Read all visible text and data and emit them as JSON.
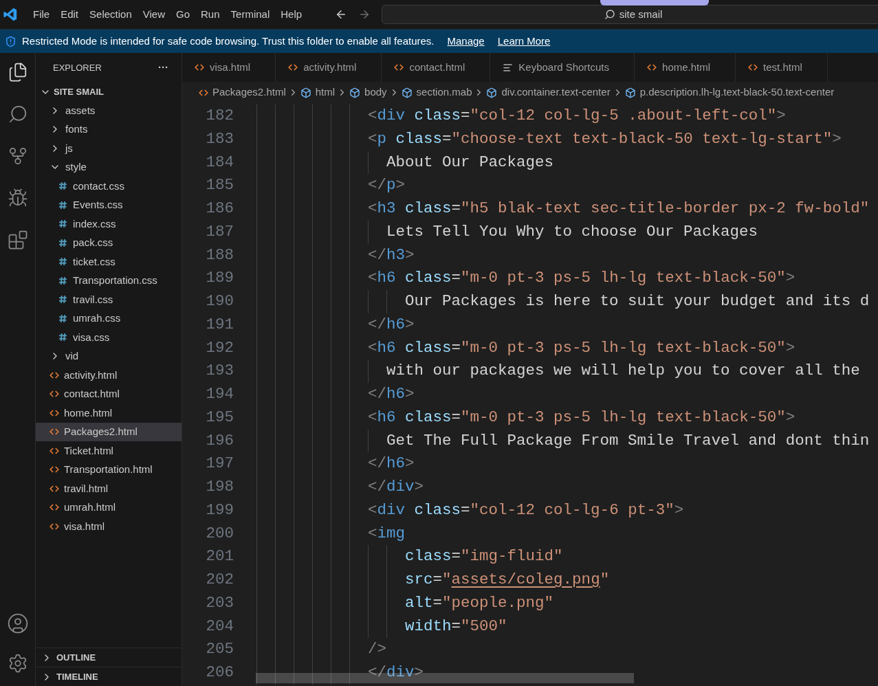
{
  "menu": [
    "File",
    "Edit",
    "Selection",
    "View",
    "Go",
    "Run",
    "Terminal",
    "Help"
  ],
  "command_center": {
    "text": "site smail"
  },
  "banner": {
    "message": "Restricted Mode is intended for safe code browsing. Trust this folder to enable all features.",
    "links": [
      "Manage",
      "Learn More"
    ]
  },
  "explorer": {
    "title": "EXPLORER",
    "more": "···",
    "folder": {
      "name": "SITE SMAIL",
      "expanded": true,
      "children": [
        {
          "kind": "folder",
          "name": "assets",
          "expanded": false,
          "selected": false
        },
        {
          "kind": "folder",
          "name": "fonts",
          "expanded": false,
          "selected": false
        },
        {
          "kind": "folder",
          "name": "js",
          "expanded": false,
          "selected": false
        },
        {
          "kind": "folder",
          "name": "style",
          "expanded": true,
          "selected": false,
          "children": [
            {
              "kind": "css",
              "name": "contact.css",
              "selected": false
            },
            {
              "kind": "css",
              "name": "Events.css",
              "selected": false
            },
            {
              "kind": "css",
              "name": "index.css",
              "selected": false
            },
            {
              "kind": "css",
              "name": "pack.css",
              "selected": false
            },
            {
              "kind": "css",
              "name": "ticket.css",
              "selected": false
            },
            {
              "kind": "css",
              "name": "Transportation.css",
              "selected": false
            },
            {
              "kind": "css",
              "name": "travil.css",
              "selected": false
            },
            {
              "kind": "css",
              "name": "umrah.css",
              "selected": false
            },
            {
              "kind": "css",
              "name": "visa.css",
              "selected": false
            }
          ]
        },
        {
          "kind": "folder",
          "name": "vid",
          "expanded": false,
          "selected": false
        },
        {
          "kind": "html",
          "name": "activity.html",
          "selected": false
        },
        {
          "kind": "html",
          "name": "contact.html",
          "selected": false
        },
        {
          "kind": "html",
          "name": "home.html",
          "selected": false
        },
        {
          "kind": "html",
          "name": "Packages2.html",
          "selected": true
        },
        {
          "kind": "html",
          "name": "Ticket.html",
          "selected": false
        },
        {
          "kind": "html",
          "name": "Transportation.html",
          "selected": false
        },
        {
          "kind": "html",
          "name": "travil.html",
          "selected": false
        },
        {
          "kind": "html",
          "name": "umrah.html",
          "selected": false
        },
        {
          "kind": "html",
          "name": "visa.html",
          "selected": false
        }
      ]
    },
    "sections": [
      {
        "title": "OUTLINE",
        "expanded": false
      },
      {
        "title": "TIMELINE",
        "expanded": false
      }
    ]
  },
  "tabs": [
    {
      "kind": "html",
      "label": "visa.html",
      "selected": false
    },
    {
      "kind": "html",
      "label": "activity.html",
      "selected": false
    },
    {
      "kind": "html",
      "label": "contact.html",
      "selected": false
    },
    {
      "kind": "settings",
      "label": "Keyboard Shortcuts",
      "selected": false
    },
    {
      "kind": "html",
      "label": "home.html",
      "selected": false
    },
    {
      "kind": "html",
      "label": "test.html",
      "selected": false
    }
  ],
  "breadcrumb": [
    {
      "kind": "html",
      "text": "Packages2.html"
    },
    {
      "kind": "element",
      "text": "html"
    },
    {
      "kind": "element",
      "text": "body"
    },
    {
      "kind": "element",
      "text": "section.mab"
    },
    {
      "kind": "element",
      "text": "div.container.text-center"
    },
    {
      "kind": "element",
      "text": "p.description.lh-lg.text-black-50.text-center"
    }
  ],
  "code": [
    {
      "number": "182",
      "tokens": [
        {
          "kind": "punct",
          "text": "            <"
        },
        {
          "kind": "tag",
          "text": "div"
        },
        {
          "kind": "attr",
          "text": " class"
        },
        {
          "kind": "op",
          "text": "="
        },
        {
          "kind": "str",
          "text": "\"col-12 col-lg-5 .about-left-col\""
        },
        {
          "kind": "punct",
          "text": ">"
        }
      ]
    },
    {
      "number": "183",
      "tokens": [
        {
          "kind": "punct",
          "text": "            <"
        },
        {
          "kind": "tag",
          "text": "p"
        },
        {
          "kind": "attr",
          "text": " class"
        },
        {
          "kind": "op",
          "text": "="
        },
        {
          "kind": "str",
          "text": "\"choose-text text-black-50 text-lg-start\""
        },
        {
          "kind": "punct",
          "text": ">"
        }
      ]
    },
    {
      "number": "184",
      "tokens": [
        {
          "kind": "text",
          "text": "              About Our Packages"
        }
      ]
    },
    {
      "number": "185",
      "tokens": [
        {
          "kind": "punct",
          "text": "            </"
        },
        {
          "kind": "tag",
          "text": "p"
        },
        {
          "kind": "punct",
          "text": ">"
        }
      ]
    },
    {
      "number": "186",
      "tokens": [
        {
          "kind": "punct",
          "text": "            <"
        },
        {
          "kind": "tag",
          "text": "h3"
        },
        {
          "kind": "attr",
          "text": " class"
        },
        {
          "kind": "op",
          "text": "="
        },
        {
          "kind": "str",
          "text": "\"h5 blak-text sec-title-border px-2 fw-bold\""
        }
      ]
    },
    {
      "number": "187",
      "tokens": [
        {
          "kind": "text",
          "text": "              Lets Tell You Why to choose Our Packages"
        }
      ]
    },
    {
      "number": "188",
      "tokens": [
        {
          "kind": "punct",
          "text": "            </"
        },
        {
          "kind": "tag",
          "text": "h3"
        },
        {
          "kind": "punct",
          "text": ">"
        }
      ]
    },
    {
      "number": "189",
      "tokens": [
        {
          "kind": "punct",
          "text": "            <"
        },
        {
          "kind": "tag",
          "text": "h6"
        },
        {
          "kind": "attr",
          "text": " class"
        },
        {
          "kind": "op",
          "text": "="
        },
        {
          "kind": "str",
          "text": "\"m-0 pt-3 ps-5 lh-lg text-black-50\""
        },
        {
          "kind": "punct",
          "text": ">"
        }
      ]
    },
    {
      "number": "190",
      "tokens": [
        {
          "kind": "text",
          "text": "                Our Packages is here to suit your budget and its d"
        }
      ]
    },
    {
      "number": "191",
      "tokens": [
        {
          "kind": "punct",
          "text": "            </"
        },
        {
          "kind": "tag",
          "text": "h6"
        },
        {
          "kind": "punct",
          "text": ">"
        }
      ]
    },
    {
      "number": "192",
      "tokens": [
        {
          "kind": "punct",
          "text": "            <"
        },
        {
          "kind": "tag",
          "text": "h6"
        },
        {
          "kind": "attr",
          "text": " class"
        },
        {
          "kind": "op",
          "text": "="
        },
        {
          "kind": "str",
          "text": "\"m-0 pt-3 ps-5 lh-lg text-black-50\""
        },
        {
          "kind": "punct",
          "text": ">"
        }
      ]
    },
    {
      "number": "193",
      "tokens": [
        {
          "kind": "text",
          "text": "              with our packages we will help you to cover all the"
        }
      ]
    },
    {
      "number": "194",
      "tokens": [
        {
          "kind": "punct",
          "text": "            </"
        },
        {
          "kind": "tag",
          "text": "h6"
        },
        {
          "kind": "punct",
          "text": ">"
        }
      ]
    },
    {
      "number": "195",
      "tokens": [
        {
          "kind": "punct",
          "text": "            <"
        },
        {
          "kind": "tag",
          "text": "h6"
        },
        {
          "kind": "attr",
          "text": " class"
        },
        {
          "kind": "op",
          "text": "="
        },
        {
          "kind": "str",
          "text": "\"m-0 pt-3 ps-5 lh-lg text-black-50\""
        },
        {
          "kind": "punct",
          "text": ">"
        }
      ]
    },
    {
      "number": "196",
      "tokens": [
        {
          "kind": "text",
          "text": "              Get The Full Package From Smile Travel and dont thin"
        }
      ]
    },
    {
      "number": "197",
      "tokens": [
        {
          "kind": "punct",
          "text": "            </"
        },
        {
          "kind": "tag",
          "text": "h6"
        },
        {
          "kind": "punct",
          "text": ">"
        }
      ]
    },
    {
      "number": "198",
      "tokens": [
        {
          "kind": "punct",
          "text": "            </"
        },
        {
          "kind": "tag",
          "text": "div"
        },
        {
          "kind": "punct",
          "text": ">"
        }
      ]
    },
    {
      "number": "199",
      "tokens": [
        {
          "kind": "punct",
          "text": "            <"
        },
        {
          "kind": "tag",
          "text": "div"
        },
        {
          "kind": "attr",
          "text": " class"
        },
        {
          "kind": "op",
          "text": "="
        },
        {
          "kind": "str",
          "text": "\"col-12 col-lg-6 pt-3\""
        },
        {
          "kind": "punct",
          "text": ">"
        }
      ]
    },
    {
      "number": "200",
      "tokens": [
        {
          "kind": "punct",
          "text": "            <"
        },
        {
          "kind": "tag",
          "text": "img"
        }
      ]
    },
    {
      "number": "201",
      "tokens": [
        {
          "kind": "attr",
          "text": "                class"
        },
        {
          "kind": "op",
          "text": "="
        },
        {
          "kind": "str",
          "text": "\"img-fluid\""
        }
      ]
    },
    {
      "number": "202",
      "tokens": [
        {
          "kind": "attr",
          "text": "                src"
        },
        {
          "kind": "op",
          "text": "="
        },
        {
          "kind": "str",
          "text": "\""
        },
        {
          "kind": "link",
          "text": "assets/coleg.png"
        },
        {
          "kind": "str",
          "text": "\""
        }
      ]
    },
    {
      "number": "203",
      "tokens": [
        {
          "kind": "attr",
          "text": "                alt"
        },
        {
          "kind": "op",
          "text": "="
        },
        {
          "kind": "str",
          "text": "\"people.png\""
        }
      ]
    },
    {
      "number": "204",
      "tokens": [
        {
          "kind": "attr",
          "text": "                width"
        },
        {
          "kind": "op",
          "text": "="
        },
        {
          "kind": "str",
          "text": "\"500\""
        }
      ]
    },
    {
      "number": "205",
      "tokens": [
        {
          "kind": "punct",
          "text": "            />"
        }
      ]
    },
    {
      "number": "206",
      "tokens": [
        {
          "kind": "punct",
          "text": "            </"
        },
        {
          "kind": "tag",
          "text": "div"
        },
        {
          "kind": "punct",
          "text": ">"
        }
      ]
    }
  ]
}
